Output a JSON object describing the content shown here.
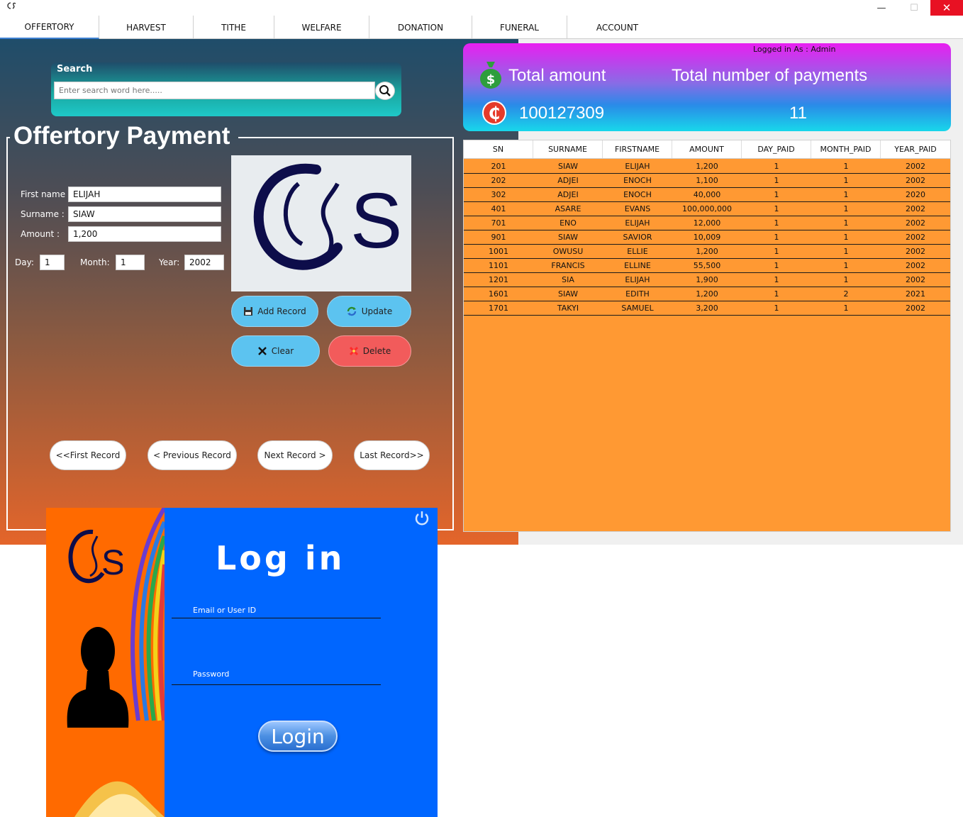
{
  "window": {
    "minimize": "—",
    "maximize": "☐",
    "close": "✕"
  },
  "tabs": [
    "OFFERTORY",
    "HARVEST",
    "TITHE",
    "WELFARE",
    "DONATION",
    "FUNERAL",
    "ACCOUNT"
  ],
  "search": {
    "label": "Search",
    "placeholder": "Enter search word here....."
  },
  "form": {
    "title": "Offertory Payment",
    "firstname_label": "First name :",
    "firstname_value": "ELIJAH",
    "surname_label": "Surname :",
    "surname_value": "SIAW",
    "amount_label": "Amount :",
    "amount_value": "1,200",
    "day_label": "Day:",
    "day_value": "1",
    "month_label": "Month:",
    "month_value": "1",
    "year_label": "Year:",
    "year_value": "2002"
  },
  "buttons": {
    "add": "Add Record",
    "update": "Update",
    "clear": "Clear",
    "delete": "Delete",
    "first": "<<First Record",
    "previous": "< Previous Record",
    "next": "Next Record >",
    "last": "Last Record>>"
  },
  "summary": {
    "logged_in": "Logged in As :   Admin",
    "total_amount_label": "Total amount",
    "total_payments_label": "Total number of payments",
    "total_amount_value": "100127309",
    "total_payments_value": "11"
  },
  "table": {
    "columns": [
      "SN",
      "SURNAME",
      "FIRSTNAME",
      "AMOUNT",
      "DAY_PAID",
      "MONTH_PAID",
      "YEAR_PAID"
    ],
    "rows": [
      [
        "201",
        "SIAW",
        "ELIJAH",
        "1,200",
        "1",
        "1",
        "2002"
      ],
      [
        "202",
        "ADJEI",
        "ENOCH",
        "1,100",
        "1",
        "1",
        "2002"
      ],
      [
        "302",
        "ADJEI",
        "ENOCH",
        "40,000",
        "1",
        "1",
        "2020"
      ],
      [
        "401",
        "ASARE",
        "EVANS",
        "100,000,000",
        "1",
        "1",
        "2002"
      ],
      [
        "701",
        "ENO",
        "ELIJAH",
        "12,000",
        "1",
        "1",
        "2002"
      ],
      [
        "901",
        "SIAW",
        "SAVIOR",
        "10,009",
        "1",
        "1",
        "2002"
      ],
      [
        "1001",
        "OWUSU",
        "ELLIE",
        "1,200",
        "1",
        "1",
        "2002"
      ],
      [
        "1101",
        "FRANCIS",
        "ELLINE",
        "55,500",
        "1",
        "1",
        "2002"
      ],
      [
        "1201",
        "SIA",
        "ELIJAH",
        "1,900",
        "1",
        "1",
        "2002"
      ],
      [
        "1601",
        "SIAW",
        "EDITH",
        "1,200",
        "1",
        "2",
        "2021"
      ],
      [
        "1701",
        "TAKYI",
        "SAMUEL",
        "3,200",
        "1",
        "1",
        "2002"
      ]
    ]
  },
  "login": {
    "title": "Log in",
    "email_label": "Email or User ID",
    "password_label": "Password",
    "button": "Login"
  },
  "colors": {
    "accent_blue": "#5cc3f0",
    "delete_red": "#f25b5b",
    "table_orange": "#ff9933",
    "login_blue": "#0066ff",
    "login_orange": "#ff6a00"
  }
}
